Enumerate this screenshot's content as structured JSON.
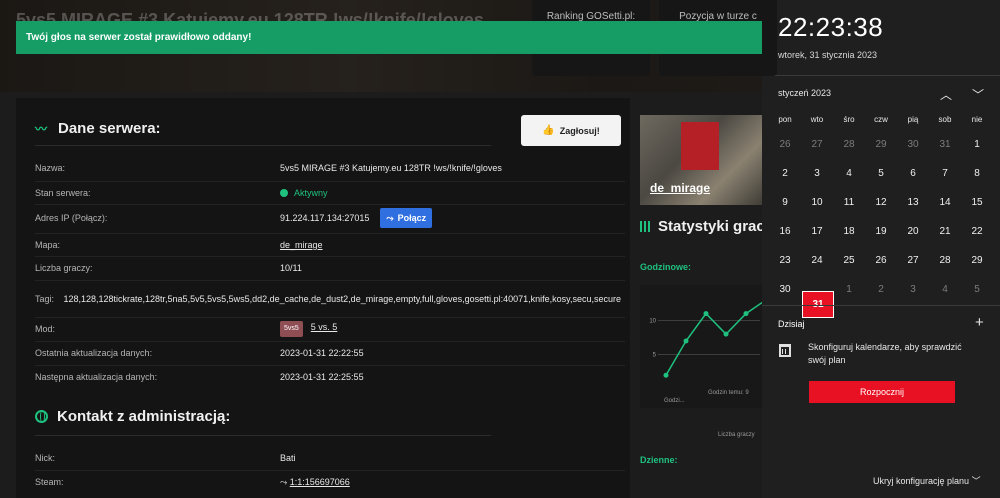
{
  "banner": {
    "title": "5vs5 MIRAGE #3 Katujemy.eu 128TR !ws/!knife/!gloves",
    "ranking_label": "Ranking GOSetti.pl:",
    "position_label": "Pozycja w turze c"
  },
  "toast": {
    "message": "Twój głos na serwer został prawidłowo oddany!"
  },
  "server": {
    "section_title": "Dane serwera:",
    "vote_label": "Zagłosuj!",
    "rows": {
      "name_label": "Nazwa:",
      "name_value": "5vs5 MIRAGE #3 Katujemy.eu 128TR !ws/!knife/!gloves",
      "status_label": "Stan serwera:",
      "status_value": "Aktywny",
      "ip_label": "Adres IP (Połącz):",
      "ip_value": "91.224.117.134:27015",
      "connect_label": "Połącz",
      "map_label": "Mapa:",
      "map_value": "de_mirage",
      "players_label": "Liczba graczy:",
      "players_value": "10/11",
      "tags_label": "Tagi:",
      "tags_value": "128,128,128tickrate,128tr,5na5,5v5,5vs5,5ws5,dd2,de_cache,de_dust2,de_mirage,empty,full,gloves,gosetti.pl:40071,knife,kosy,secu,secure",
      "mod_label": "Mod:",
      "mod_badge": "5vs5",
      "mod_value": "5 vs. 5",
      "last_update_label": "Ostatnia aktualizacja danych:",
      "last_update_value": "2023-01-31 22:22:55",
      "next_update_label": "Następna aktualizacja danych:",
      "next_update_value": "2023-01-31 22:25:55"
    }
  },
  "contact": {
    "section_title": "Kontakt z administracją:",
    "nick_label": "Nick:",
    "nick_value": "Bati",
    "steam_label": "Steam:",
    "steam_value": "1:1:156697066"
  },
  "side": {
    "map_name": "de_mirage",
    "stats_title": "Statystyki gracz",
    "hourly_label": "Godzinowe:",
    "daily_label": "Dzienne:",
    "chart_caption": "Liczba graczy"
  },
  "chart_data": {
    "type": "line",
    "title": "",
    "xlabel": "",
    "ylabel": "Liczba graczy",
    "x": [
      "Godzi...",
      "",
      "Godzin temu: 9",
      "",
      "",
      ""
    ],
    "y_ticks": [
      5,
      10
    ],
    "values": [
      2,
      7,
      11,
      8,
      11,
      13
    ],
    "ylim": [
      0,
      14
    ],
    "grid": true
  },
  "flyout": {
    "time": "22:23:38",
    "date": "wtorek, 31 stycznia 2023",
    "month": "styczeń 2023",
    "weekdays": [
      "pon",
      "wto",
      "śro",
      "czw",
      "pią",
      "sob",
      "nie"
    ],
    "weeks": [
      [
        "26",
        "27",
        "28",
        "29",
        "30",
        "31",
        "1"
      ],
      [
        "2",
        "3",
        "4",
        "5",
        "6",
        "7",
        "8"
      ],
      [
        "9",
        "10",
        "11",
        "12",
        "13",
        "14",
        "15"
      ],
      [
        "16",
        "17",
        "18",
        "19",
        "20",
        "21",
        "22"
      ],
      [
        "23",
        "24",
        "25",
        "26",
        "27",
        "28",
        "29"
      ],
      [
        "30",
        "31",
        "1",
        "2",
        "3",
        "4",
        "5"
      ]
    ],
    "today": "31",
    "today_label": "Dzisiaj",
    "plan_text": "Skonfiguruj kalendarze, aby sprawdzić swój plan",
    "start_label": "Rozpocznij",
    "hide_label": "Ukryj konfigurację planu"
  },
  "colors": {
    "accent_green": "#1fc17f",
    "toast_green": "#169d66",
    "windows_red": "#e81123",
    "connect_blue": "#2f6fe0"
  }
}
